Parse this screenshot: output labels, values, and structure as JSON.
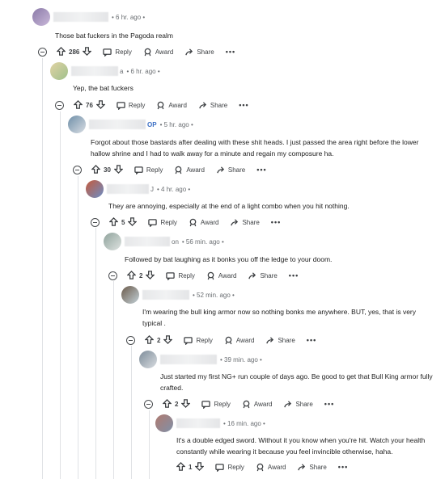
{
  "comments": [
    {
      "time": "• 6 hr. ago •",
      "body": "Those bat fuckers in the Pagoda realm",
      "votes": "286",
      "reply": "Reply",
      "award": "Award",
      "share": "Share",
      "more": "•••"
    },
    {
      "name_suffix": "a",
      "time": "• 6 hr. ago •",
      "body": "Yep, the bat fuckers",
      "votes": "76",
      "reply": "Reply",
      "award": "Award",
      "share": "Share",
      "more": "•••"
    },
    {
      "op_label": "OP",
      "time": "• 5 hr. ago •",
      "body": "Forgot about those bastards after dealing with these shit heads. I just passed the area right before the lower hallow shrine and I had to walk away for a minute and regain my composure ha.",
      "votes": "30",
      "reply": "Reply",
      "award": "Award",
      "share": "Share",
      "more": "•••"
    },
    {
      "name_suffix": "J",
      "time": "• 4 hr. ago •",
      "body": "They are annoying, especially at the end of a light combo when you hit nothing.",
      "votes": "5",
      "reply": "Reply",
      "award": "Award",
      "share": "Share",
      "more": "•••"
    },
    {
      "name_suffix": "on",
      "time": "• 56 min. ago •",
      "body": "Followed by bat laughing as it bonks you off the ledge to your doom.",
      "votes": "2",
      "reply": "Reply",
      "award": "Award",
      "share": "Share",
      "more": "•••"
    },
    {
      "time": "• 52 min. ago •",
      "body": "I'm wearing the bull king armor now so nothing bonks me anywhere. BUT, yes, that is very typical .",
      "votes": "2",
      "reply": "Reply",
      "award": "Award",
      "share": "Share",
      "more": "•••"
    },
    {
      "time": "• 39 min. ago •",
      "body": "Just started my first NG+ run couple of days ago. Be good to get that Bull King armor fully crafted.",
      "votes": "2",
      "reply": "Reply",
      "award": "Award",
      "share": "Share",
      "more": "•••"
    },
    {
      "time": "• 16 min. ago •",
      "body": "It's a double edged sword. Without it you know when you're hit. Watch your health constantly while wearing it because you feel invincible otherwise, haha.",
      "votes": "1",
      "reply": "Reply",
      "award": "Award",
      "share": "Share",
      "more": "•••"
    }
  ]
}
